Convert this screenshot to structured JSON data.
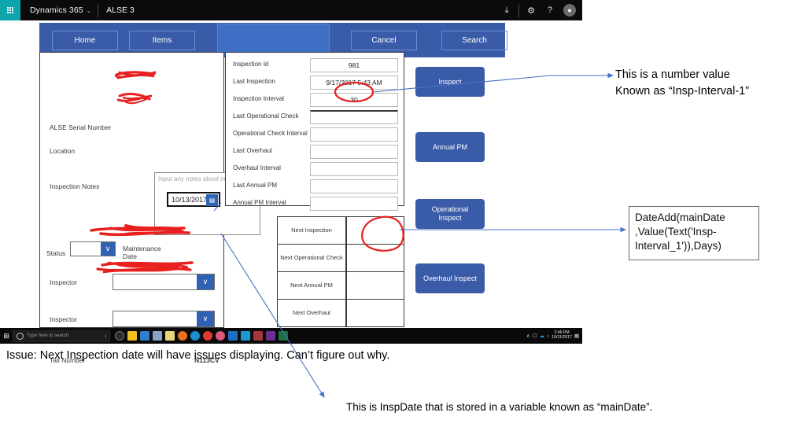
{
  "topbar": {
    "waffle_icon": "waffle-grid-icon",
    "brand": "Dynamics 365",
    "brand_chevron": "⌄",
    "app_name": "ALSE 3",
    "download_icon": "⤓",
    "settings_icon": "⚙",
    "help_icon": "?",
    "avatar_icon": "♟"
  },
  "navbar": {
    "home_label": "Home",
    "items_label": "Items",
    "cancel_label": "Cancel",
    "search_label": "Search",
    "highlight_label": ""
  },
  "form": {
    "serial_label": "ALSE Serial Number",
    "serial_value": "",
    "location_label": "Location",
    "location_value": "",
    "notes_label": "Inspection Notes",
    "notes_placeholder": "Input any notes about inspection",
    "notes_value": "",
    "status_label": "Status",
    "status_value": "",
    "maintenance_label_line1": "Maintenance",
    "maintenance_label_line2": "Date",
    "maintenance_date": "10/13/2017",
    "calendar_icon": "▤",
    "chevron_icon": "∨",
    "inspector1_label": "Inspector",
    "inspector1_value": "",
    "inspector2_label": "Inspector",
    "inspector2_value": "",
    "tail_label": "Tail Number",
    "tail_value": "N113CV"
  },
  "details": {
    "rows": [
      {
        "label": "Inspection Id",
        "value": "981"
      },
      {
        "label": "Last Inspection",
        "value": "9/17/2017 5:43 AM"
      },
      {
        "label": "Inspection Interval",
        "value": "30"
      },
      {
        "label": "Last Operational Check",
        "value": ""
      },
      {
        "label": "Operational Check Interval",
        "value": ""
      },
      {
        "label": "Last Overhaul",
        "value": ""
      },
      {
        "label": "Overhaul Interval",
        "value": ""
      },
      {
        "label": "Last Annual PM",
        "value": ""
      },
      {
        "label": "Annual PM Interval",
        "value": ""
      }
    ]
  },
  "next_grid": {
    "rows": [
      {
        "label": "Next Inspection",
        "value": ""
      },
      {
        "label": "Next Operational Check",
        "value": ""
      },
      {
        "label": "Next Annual PM",
        "value": ""
      },
      {
        "label": "Next Overhaul",
        "value": ""
      }
    ]
  },
  "actions": {
    "inspect": "Inspect",
    "annual_pm": "Annual PM",
    "operational_inspect": "Operational\nInspect",
    "operational_inspect_l1": "Operational",
    "operational_inspect_l2": "Inspect",
    "overhaul_inspect": "Overhaul Inspect"
  },
  "taskbar": {
    "start_icon": "⊞",
    "search_placeholder": "Type here to search",
    "cortana_icon": "cortana-circle-icon",
    "mic_icon": "↓",
    "tray_up_icon": "∧",
    "time": "2:46 PM",
    "date": "10/11/2017"
  },
  "annotations": {
    "number_value_l1": "This is a number value",
    "number_value_l2": "Known as “Insp-Interval-1”",
    "formula_l1": "DateAdd(mainDate",
    "formula_l2": ",Value(Text('Insp-",
    "formula_l3": "Interval_1')),Days)",
    "issue": "Issue: Next Inspection date will have issues displaying. Can’t figure out why.",
    "maindate": "This is InspDate that is stored in a variable known as “mainDate”."
  },
  "colors": {
    "nav_blue": "#3a5ba8",
    "nav_highlight": "#3f6fc4",
    "accent_teal": "#0ea5ad",
    "redaction_red": "#e8201f",
    "arrow_blue": "#4472c4"
  }
}
